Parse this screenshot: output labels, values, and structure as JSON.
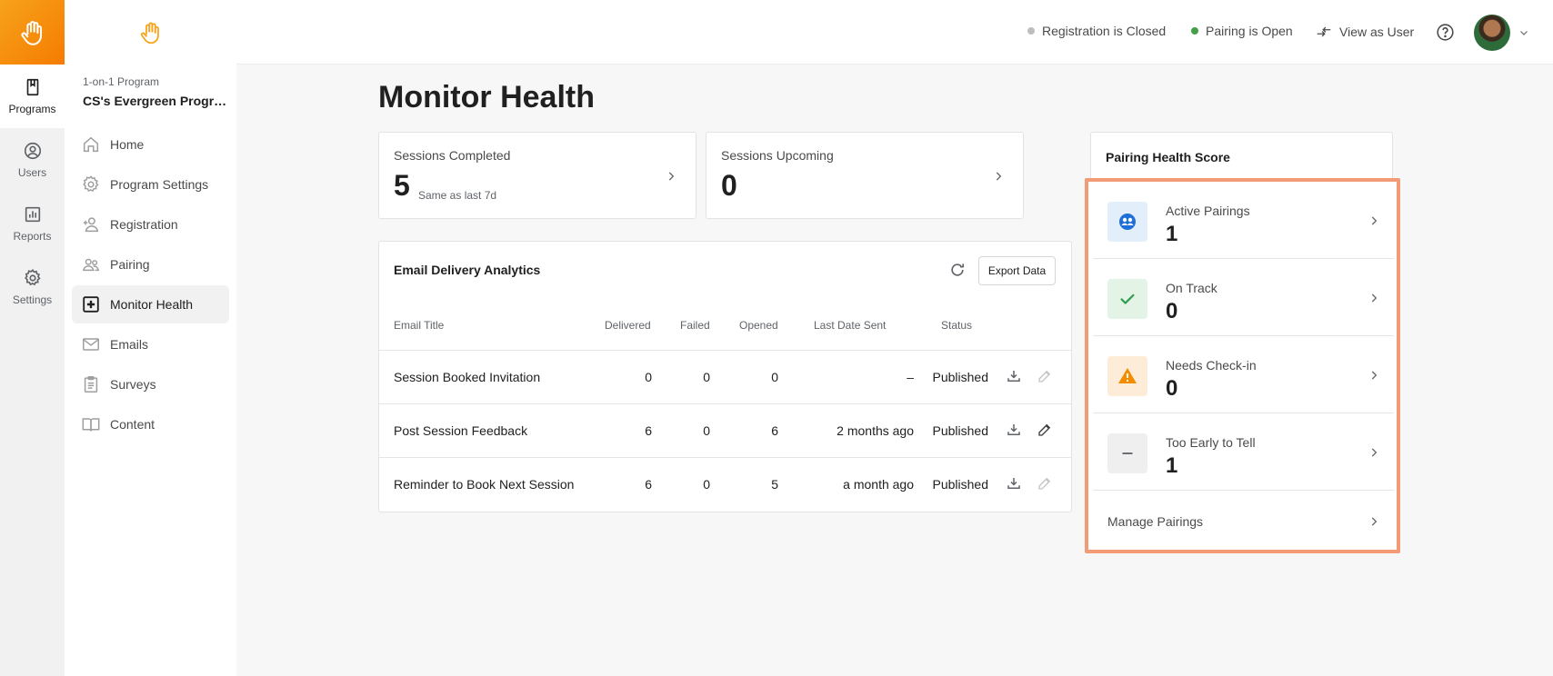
{
  "colors": {
    "brand": "#f57c00",
    "highlight": "#f39a76",
    "open": "#43a047",
    "closed": "#bdbdbd"
  },
  "rail": {
    "items": [
      {
        "label": "Programs",
        "icon": "book-icon"
      },
      {
        "label": "Users",
        "icon": "user-circle-icon"
      },
      {
        "label": "Reports",
        "icon": "chart-icon"
      },
      {
        "label": "Settings",
        "icon": "gear-icon"
      }
    ]
  },
  "program": {
    "type": "1-on-1 Program",
    "name": "CS's Evergreen Program"
  },
  "nav": {
    "items": [
      {
        "label": "Home",
        "icon": "home-icon"
      },
      {
        "label": "Program Settings",
        "icon": "gear-icon"
      },
      {
        "label": "Registration",
        "icon": "person-add-icon"
      },
      {
        "label": "Pairing",
        "icon": "people-icon"
      },
      {
        "label": "Monitor Health",
        "icon": "plus-box-icon"
      },
      {
        "label": "Emails",
        "icon": "mail-icon"
      },
      {
        "label": "Surveys",
        "icon": "clipboard-icon"
      },
      {
        "label": "Content",
        "icon": "book-open-icon"
      }
    ]
  },
  "topbar": {
    "registration": "Registration is Closed",
    "pairing": "Pairing is Open",
    "view_as_user": "View as User"
  },
  "page": {
    "title": "Monitor Health"
  },
  "stats": {
    "completed": {
      "label": "Sessions Completed",
      "value": "5",
      "note": "Same as last 7d"
    },
    "upcoming": {
      "label": "Sessions Upcoming",
      "value": "0"
    }
  },
  "email": {
    "title": "Email Delivery Analytics",
    "export_label": "Export Data",
    "headers": {
      "title": "Email Title",
      "delivered": "Delivered",
      "failed": "Failed",
      "opened": "Opened",
      "last_sent": "Last Date Sent",
      "status": "Status"
    },
    "rows": [
      {
        "title": "Session Booked Invitation",
        "delivered": "0",
        "failed": "0",
        "opened": "0",
        "last_sent": "–",
        "status": "Published",
        "edit_enabled": false
      },
      {
        "title": "Post Session Feedback",
        "delivered": "6",
        "failed": "0",
        "opened": "6",
        "last_sent": "2 months ago",
        "status": "Published",
        "edit_enabled": true
      },
      {
        "title": "Reminder to Book Next Session",
        "delivered": "6",
        "failed": "0",
        "opened": "5",
        "last_sent": "a month ago",
        "status": "Published",
        "edit_enabled": false
      }
    ]
  },
  "pairing_health": {
    "title": "Pairing Health Score",
    "items": [
      {
        "label": "Active Pairings",
        "value": "1",
        "icon": "pairing-icon",
        "bg": "#e3eefb"
      },
      {
        "label": "On Track",
        "value": "0",
        "icon": "check-icon",
        "bg": "#e3f3e6"
      },
      {
        "label": "Needs Check-in",
        "value": "0",
        "icon": "warning-icon",
        "bg": "#fdecd8"
      },
      {
        "label": "Too Early to Tell",
        "value": "1",
        "icon": "dash-icon",
        "bg": "#efefef"
      }
    ],
    "manage_label": "Manage Pairings"
  }
}
